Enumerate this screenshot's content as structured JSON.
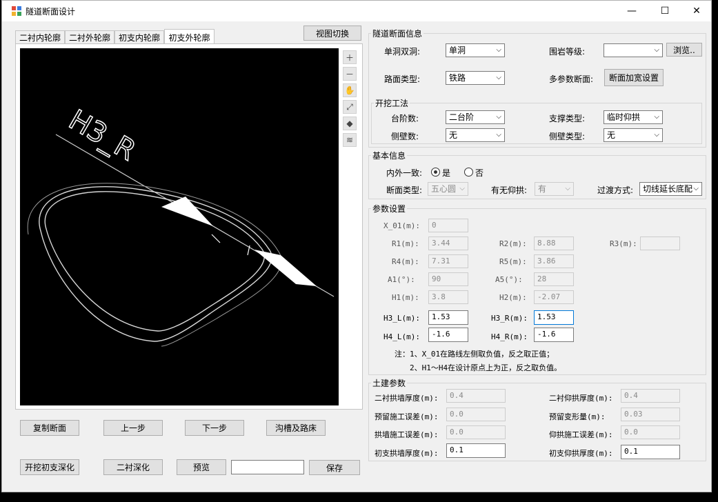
{
  "window": {
    "title": "隧道断面设计",
    "minimize": "—",
    "maximize": "☐",
    "close": "✕"
  },
  "tabs": [
    "二衬内轮廓",
    "二衬外轮廓",
    "初支内轮廓",
    "初支外轮廓"
  ],
  "view_switch": "视图切换",
  "drawing": {
    "label": "H3_R"
  },
  "toolbar_icons": [
    "zoom-in-icon",
    "zoom-out-icon",
    "pan-hand-icon",
    "fit-view-icon",
    "3d-cube-icon",
    "layers-icon"
  ],
  "buttons": {
    "copy_section": "复制断面",
    "prev_step": "上一步",
    "next_step": "下一步",
    "ditch_roadbed": "沟槽及路床",
    "excavation_support": "开挖初支深化",
    "secondary_lining": "二衬深化",
    "preview": "预览",
    "preview_value": "",
    "save": "保存"
  },
  "tunnel_info": {
    "title": "隧道断面信息",
    "single_double_label": "单洞双洞:",
    "single_double_value": "单洞",
    "rock_grade_label": "围岩等级:",
    "rock_grade_value": "",
    "browse": "浏览..",
    "road_type_label": "路面类型:",
    "road_type_value": "铁路",
    "multi_param_label": "多参数断面:",
    "widen_button": "断面加宽设置",
    "excavation": {
      "title": "开挖工法",
      "steps_label": "台阶数:",
      "steps_value": "二台阶",
      "support_type_label": "支撑类型:",
      "support_type_value": "临时仰拱",
      "side_wall_count_label": "侧壁数:",
      "side_wall_count_value": "无",
      "side_wall_type_label": "侧壁类型:",
      "side_wall_type_value": "无"
    }
  },
  "basic_info": {
    "title": "基本信息",
    "consistent_label": "内外一致:",
    "yes": "是",
    "no": "否",
    "section_type_label": "断面类型:",
    "section_type_value": "五心圆",
    "invert_label": "有无仰拱:",
    "invert_value": "有",
    "transition_label": "过渡方式:",
    "transition_value": "切线延长底配"
  },
  "params": {
    "title": "参数设置",
    "X_01_label": "X_01(m):",
    "X_01": "0",
    "R1_label": "R1(m):",
    "R1": "3.44",
    "R2_label": "R2(m):",
    "R2": "8.88",
    "R3_label": "R3(m):",
    "R3": "",
    "R4_label": "R4(m):",
    "R4": "7.31",
    "R5_label": "R5(m):",
    "R5": "3.86",
    "A1_label": "A1(°):",
    "A1": "90",
    "A5_label": "A5(°):",
    "A5": "28",
    "H1_label": "H1(m):",
    "H1": "3.8",
    "H2_label": "H2(m):",
    "H2": "-2.07",
    "H3_L_label": "H3_L(m):",
    "H3_L": "1.53",
    "H3_R_label": "H3_R(m):",
    "H3_R": "1.53",
    "H4_L_label": "H4_L(m):",
    "H4_L": "-1.6",
    "H4_R_label": "H4_R(m):",
    "H4_R": "-1.6",
    "note1": "注：1、X_01在路线左侧取负值，反之取正值；",
    "note2": "2、H1～H4在设计原点上为正，反之取负值。"
  },
  "civil": {
    "title": "土建参数",
    "arch_wall_thick_label": "二衬拱墙厚度(m):",
    "arch_wall_thick": "0.4",
    "invert_thick_label": "二衬仰拱厚度(m):",
    "invert_thick": "0.4",
    "reserved_error_label": "预留施工误差(m):",
    "reserved_error": "0.0",
    "reserved_deform_label": "预留变形量(m):",
    "reserved_deform": "0.03",
    "arch_error_label": "拱墙施工误差(m):",
    "arch_error": "0.0",
    "invert_error_label": "仰拱施工误差(m):",
    "invert_error": "0.0",
    "support_arch_label": "初支拱墙厚度(m):",
    "support_arch": "0.1",
    "support_invert_label": "初支仰拱厚度(m):",
    "support_invert": "0.1"
  }
}
